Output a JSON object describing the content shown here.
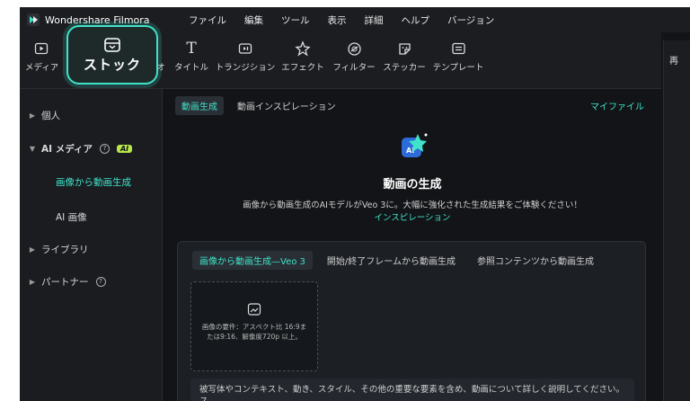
{
  "app": {
    "name": "Wondershare Filmora"
  },
  "menu": [
    "ファイル",
    "編集",
    "ツール",
    "表示",
    "詳細",
    "ヘルプ",
    "バージョン"
  ],
  "toolbar": {
    "media_label": "メディア",
    "stock_label": "ストック",
    "audio_partial": "オ",
    "title_label": "タイトル",
    "transition_label": "トランジション",
    "effect_label": "エフェクト",
    "filter_label": "フィルター",
    "sticker_label": "ステッカー",
    "template_label": "テンプレート",
    "right_panel_label": "再"
  },
  "sidebar": {
    "personal": "個人",
    "ai_media": "AI メディア",
    "ai_badge": "AI",
    "image_to_video": "画像から動画生成",
    "ai_image": "AI 画像",
    "library": "ライブラリ",
    "partner": "パートナー"
  },
  "main": {
    "tab_generate": "動画生成",
    "tab_inspiration": "動画インスピレーション",
    "my_files": "マイファイル",
    "hero_title": "動画の生成",
    "hero_desc": "画像から動画生成のAIモデルがVeo 3に。大幅に強化された生成結果をご体験ください！",
    "hero_link": "インスピレーション"
  },
  "card": {
    "tab1": "画像から動画生成—Veo 3",
    "tab2": "開始/終了フレームから動画生成",
    "tab3": "参照コンテンツから動画生成",
    "upload_text": "画像の要件：アスペクト比 16:9または9:16、解像度720p 以上。",
    "prompt_placeholder": "被写体やコンテキスト、動き、スタイル、その他の重要な要素を含め、動画について詳しく説明してください。ス"
  },
  "colors": {
    "accent": "#3fe3c8",
    "background": "#121417",
    "panel": "#1b1d21"
  }
}
